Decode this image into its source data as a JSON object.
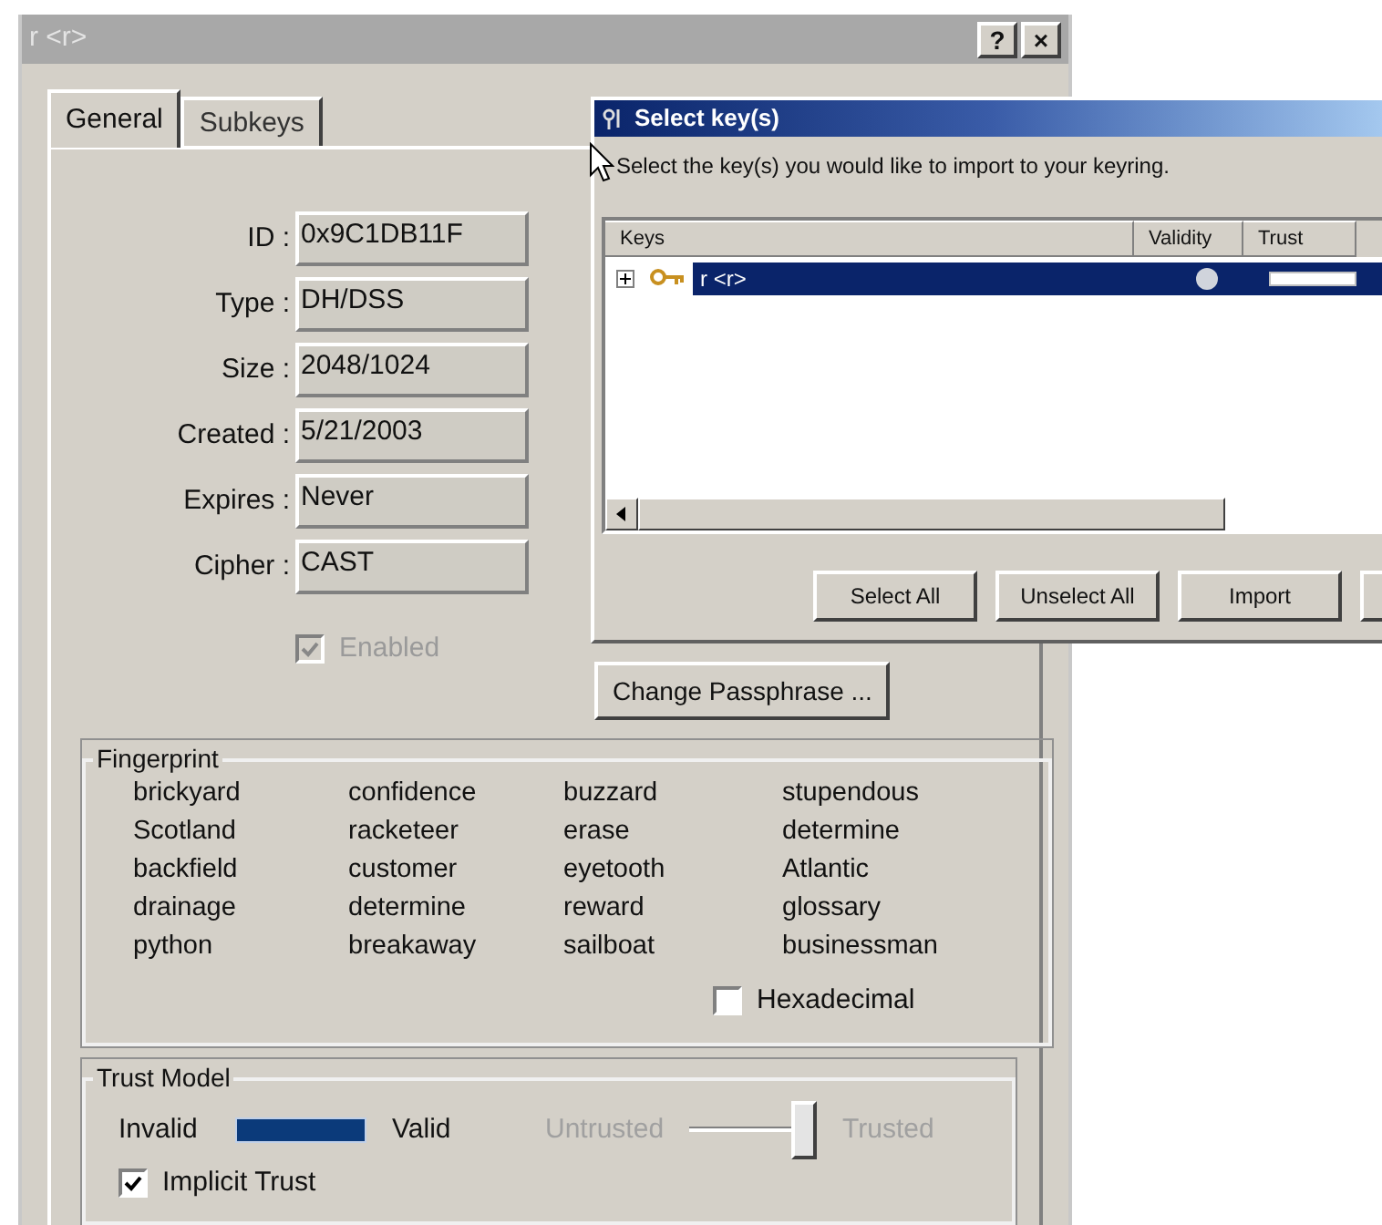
{
  "window": {
    "title": "r <r>",
    "title_buttons": [
      "?",
      "×"
    ]
  },
  "tabs": [
    {
      "label": "General",
      "selected": true
    },
    {
      "label": "Subkeys",
      "selected": false
    }
  ],
  "fields": [
    {
      "label": "ID :",
      "value": "0x9C1DB11F"
    },
    {
      "label": "Type :",
      "value": "DH/DSS"
    },
    {
      "label": "Size :",
      "value": "2048/1024"
    },
    {
      "label": "Created :",
      "value": "5/21/2003"
    },
    {
      "label": "Expires :",
      "value": "Never"
    },
    {
      "label": "Cipher :",
      "value": "CAST"
    }
  ],
  "enabled": {
    "label": "Enabled",
    "checked": true,
    "disabled": true
  },
  "change_passphrase_button": "Change Passphrase ...",
  "fingerprint": {
    "title": "Fingerprint",
    "words": [
      [
        "brickyard",
        "confidence",
        "buzzard",
        "stupendous"
      ],
      [
        "Scotland",
        "racketeer",
        "erase",
        "determine"
      ],
      [
        "backfield",
        "customer",
        "eyetooth",
        "Atlantic"
      ],
      [
        "drainage",
        "determine",
        "reward",
        "glossary"
      ],
      [
        "python",
        "breakaway",
        "sailboat",
        "businessman"
      ]
    ],
    "hexadecimal": {
      "label": "Hexadecimal",
      "checked": false
    }
  },
  "trust_model": {
    "title": "Trust Model",
    "validity": {
      "low_label": "Invalid",
      "high_label": "Valid",
      "level": 1
    },
    "trust": {
      "low_label": "Untrusted",
      "high_label": "Trusted",
      "level": 1,
      "disabled": true
    },
    "implicit_trust": {
      "label": "Implicit Trust",
      "checked": true
    }
  },
  "select_dialog": {
    "title": "Select key(s)",
    "instruction": "Select the key(s) you would like to import to your keyring.",
    "columns": [
      "Keys",
      "Validity",
      "Trust"
    ],
    "rows": [
      {
        "name": "r <r>",
        "selected": true,
        "expanded": false,
        "level": 1
      }
    ],
    "buttons": [
      "Select All",
      "Unselect All",
      "Import"
    ]
  }
}
